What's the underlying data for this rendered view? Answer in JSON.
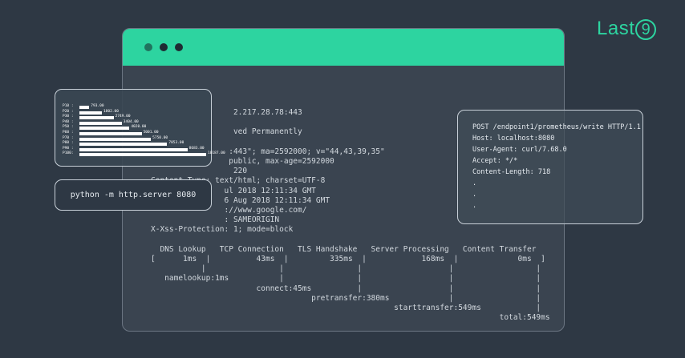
{
  "brand": {
    "name": "Last",
    "digit": "9"
  },
  "terminal": {
    "lines": [
      "                  2.217.28.78:443",
      "",
      "                  ved Permanently",
      "",
      "                 :443\"; ma=2592000; v=\"44,43,39,35\"",
      "                 public, max-age=2592000",
      "                  220",
      "Content-Type: text/html; charset=UTF-8",
      "                ul 2018 12:11:34 GMT",
      "                6 Aug 2018 12:11:34 GMT",
      "                ://www.google.com/",
      "                : SAMEORIGIN",
      "X-Xss-Protection: 1; mode=block",
      "",
      "  DNS Lookup   TCP Connection   TLS Handshake   Server Processing   Content Transfer",
      "[      1ms  |          43ms  |         335ms  |            168ms  |             0ms  ]",
      "           |                |                |                   |                  |",
      "   namelookup:1ms           |                |                   |                  |",
      "                       connect:45ms          |                   |                  |",
      "                                   pretransfer:380ms             |                  |",
      "                                                     starttransfer:549ms            |",
      "                                                                            total:549ms"
    ]
  },
  "command": {
    "text": "python -m http.server 8080"
  },
  "request": {
    "lines": [
      "POST /endpoint1/prometheus/write HTTP/1.1",
      "Host: localhost:8080",
      "User-Agent: curl/7.68.0",
      "Accept: */*",
      "Content-Length: 718",
      ".",
      ".",
      "."
    ]
  },
  "chart_data": {
    "type": "bar",
    "orientation": "horizontal",
    "categories": [
      "P10 :",
      "P20 :",
      "P30 :",
      "P40 :",
      "P50 :",
      "P60 :",
      "P70 :",
      "P80 :",
      "P90 :",
      "P100:"
    ],
    "values": [
      793.0,
      1802.0,
      2749.0,
      3404.0,
      4020.0,
      5001.0,
      5750.0,
      7053.0,
      8683.0,
      10187.0
    ],
    "value_labels": [
      "793.00",
      "1802.00",
      "2749.00",
      "3404.00",
      "4020.00",
      "5001.00",
      "5750.00",
      "7053.00",
      "8683.00",
      "10187.00"
    ],
    "xlim": [
      0,
      10187
    ]
  }
}
